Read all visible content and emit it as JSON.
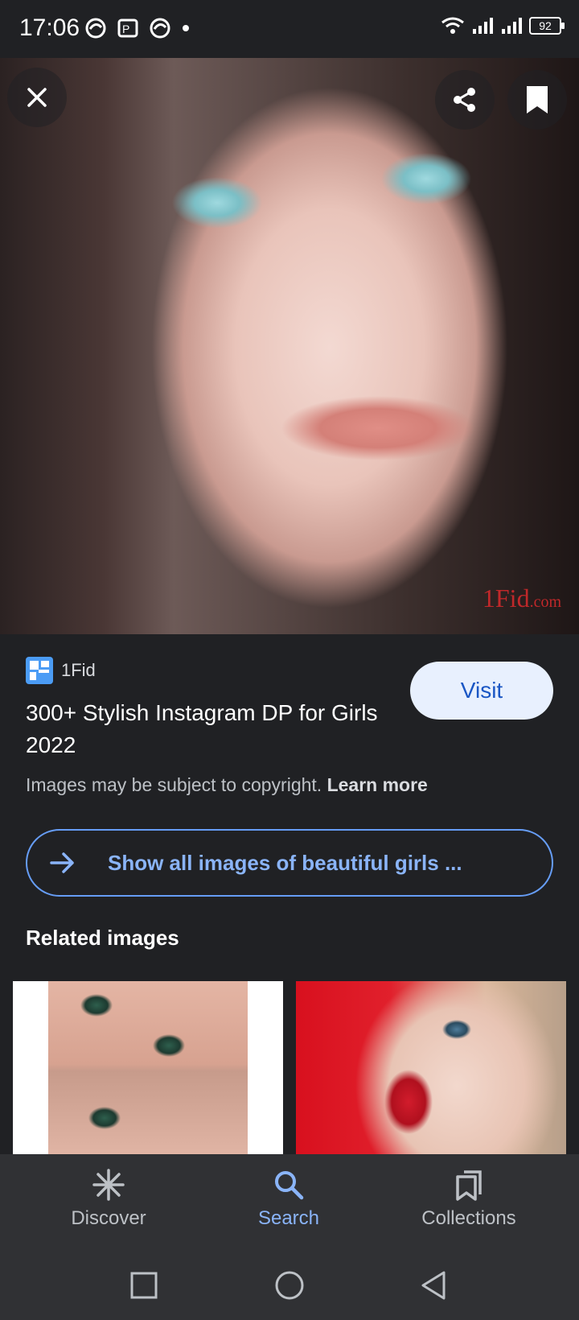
{
  "status_bar": {
    "time": "17:06",
    "battery": "92"
  },
  "hero": {
    "watermark_main": "1Fid",
    "watermark_suffix": ".com"
  },
  "result": {
    "source_name": "1Fid",
    "title": "300+ Stylish Instagram DP for Girls 2022",
    "visit_label": "Visit",
    "copyright_text": "Images may be subject to copyright.",
    "learn_more_label": "Learn more"
  },
  "show_all_label": "Show all images of beautiful girls ...",
  "related": {
    "heading": "Related images"
  },
  "bottom_nav": {
    "items": [
      {
        "label": "Discover",
        "icon": "asterisk-icon"
      },
      {
        "label": "Search",
        "icon": "search-icon"
      },
      {
        "label": "Collections",
        "icon": "collections-icon"
      }
    ],
    "active": "Search"
  },
  "colors": {
    "background": "#202124",
    "accent": "#8ab4f8",
    "visit_bg": "#e8f0fe"
  }
}
